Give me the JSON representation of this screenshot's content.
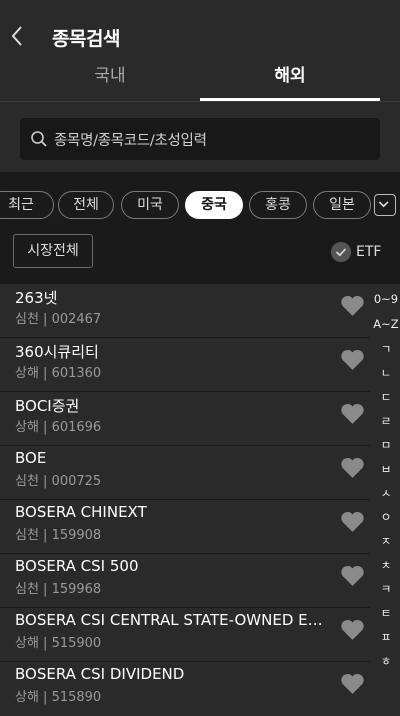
{
  "header": {
    "title": "종목검색"
  },
  "tabs": [
    {
      "label": "국내"
    },
    {
      "label": "해외"
    }
  ],
  "search": {
    "placeholder": "종목명/종목코드/초성입력"
  },
  "chips": [
    {
      "label": "최근"
    },
    {
      "label": "전체"
    },
    {
      "label": "미국"
    },
    {
      "label": "중국"
    },
    {
      "label": "홍콩"
    },
    {
      "label": "일본"
    }
  ],
  "filter": {
    "market_label": "시장전체",
    "etf_label": "ETF"
  },
  "stocks": [
    {
      "name": "263넷",
      "meta": "심천 | 002467"
    },
    {
      "name": "360시큐리티",
      "meta": "상해 | 601360"
    },
    {
      "name": "BOCI증권",
      "meta": "상해 | 601696"
    },
    {
      "name": "BOE",
      "meta": "심천 | 000725"
    },
    {
      "name": "BOSERA CHINEXT",
      "meta": "심천 | 159908"
    },
    {
      "name": "BOSERA CSI 500",
      "meta": "심천 | 159968"
    },
    {
      "name": "BOSERA CSI CENTRAL STATE-OWNED E…",
      "meta": "상해 | 515900"
    },
    {
      "name": "BOSERA CSI DIVIDEND",
      "meta": "상해 | 515890"
    }
  ],
  "index": [
    "0~9",
    "A~Z",
    "ㄱ",
    "ㄴ",
    "ㄷ",
    "ㄹ",
    "ㅁ",
    "ㅂ",
    "ㅅ",
    "ㅇ",
    "ㅈ",
    "ㅊ",
    "ㅋ",
    "ㅌ",
    "ㅍ",
    "ㅎ"
  ]
}
